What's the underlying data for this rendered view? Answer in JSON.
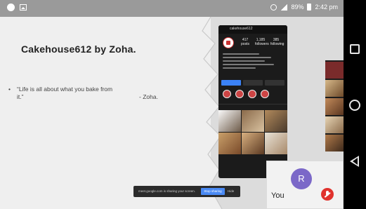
{
  "status_bar": {
    "battery": "89%",
    "time": "2:42 pm"
  },
  "slide": {
    "title": "Cakehouse612 by Zoha.",
    "bullet_symbol": "•",
    "quote_line1": "“Life is all about what you bake from",
    "quote_line2": "it.”",
    "author": "- Zoha."
  },
  "phone_mockup": {
    "handle": "cakehouse612",
    "stats": [
      {
        "value": "417",
        "label": "posts"
      },
      {
        "value": "1,185",
        "label": "followers"
      },
      {
        "value": "385",
        "label": "following"
      }
    ]
  },
  "self_tile": {
    "avatar_initial": "R",
    "label": "You"
  },
  "share_banner": {
    "message": "meet.google.com is sharing your screen.",
    "stop_label": "Stop sharing",
    "hide_label": "Hide"
  },
  "colors": {
    "avatar": "#7b68c8",
    "mic_off": "#e0322d",
    "stop_button": "#4a8af4"
  }
}
